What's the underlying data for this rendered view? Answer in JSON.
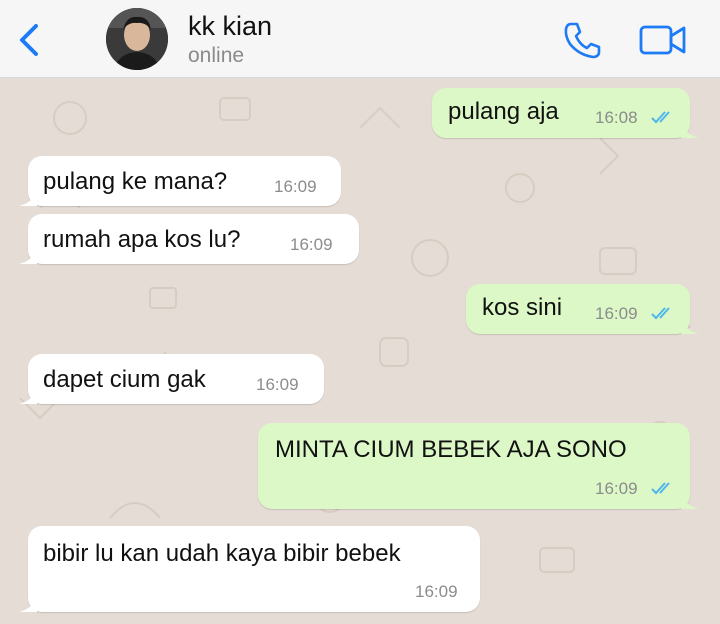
{
  "header": {
    "back_icon": "chevron-left-icon",
    "contact_name": "kk kian",
    "contact_status": "online",
    "call_icon": "phone-icon",
    "video_icon": "video-camera-icon",
    "accent_color": "#1e7bf6"
  },
  "messages": [
    {
      "direction": "outgoing",
      "text": "pulang aja",
      "time": "16:08",
      "status": "read"
    },
    {
      "direction": "incoming",
      "text": "pulang ke mana?",
      "time": "16:09"
    },
    {
      "direction": "incoming",
      "text": "rumah apa kos lu?",
      "time": "16:09"
    },
    {
      "direction": "outgoing",
      "text": "kos sini",
      "time": "16:09",
      "status": "read"
    },
    {
      "direction": "incoming",
      "text": "dapet cium gak",
      "time": "16:09"
    },
    {
      "direction": "outgoing",
      "text": "MINTA CIUM BEBEK AJA SONO",
      "time": "16:09",
      "status": "read"
    },
    {
      "direction": "incoming",
      "text": "bibir lu kan udah kaya bibir bebek",
      "time": "16:09"
    }
  ],
  "colors": {
    "incoming_bubble": "#ffffff",
    "outgoing_bubble": "#dcf8c6",
    "read_ticks": "#4fb6ec",
    "wallpaper": "#e5ddd5"
  }
}
